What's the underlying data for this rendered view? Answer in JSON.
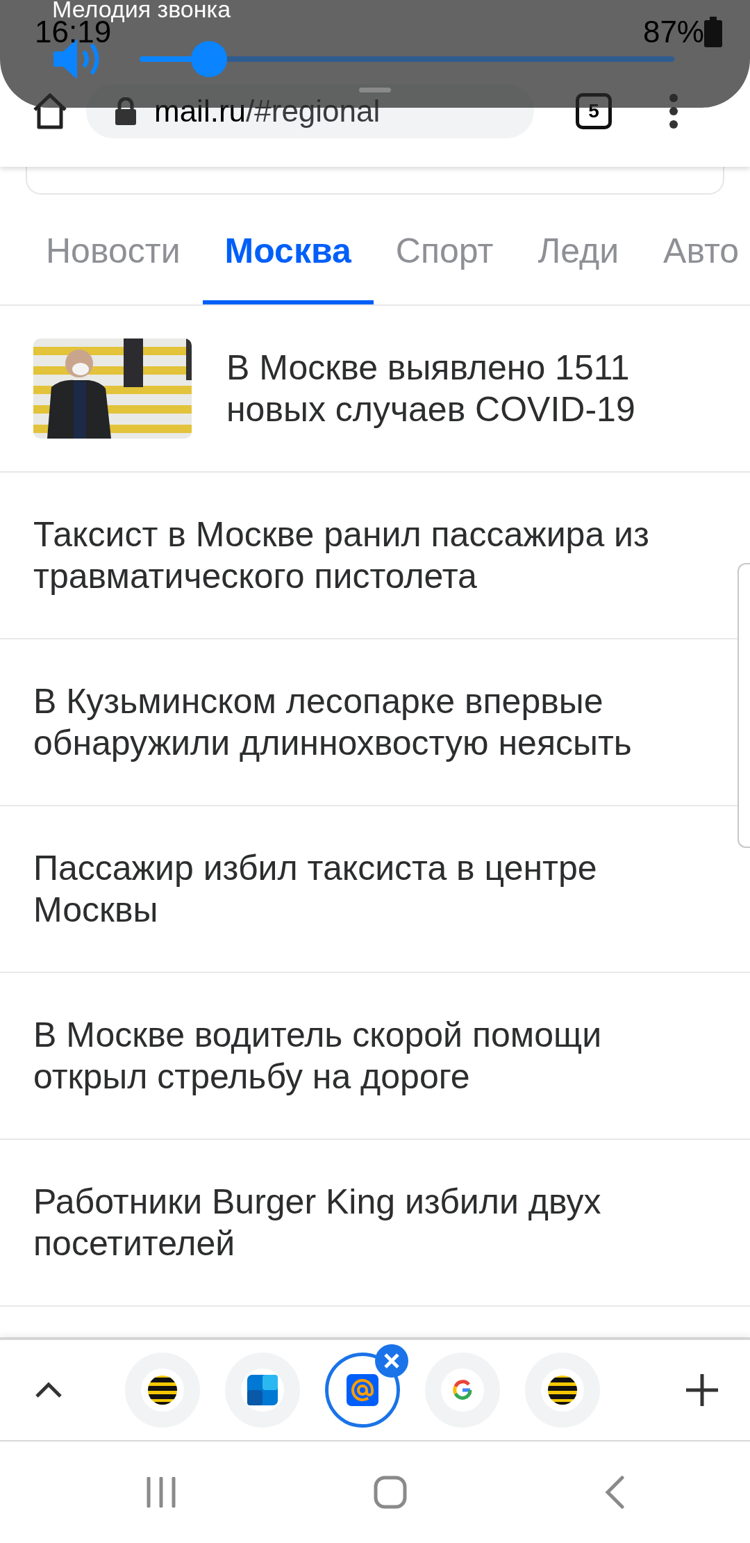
{
  "volume_panel": {
    "title": "Мелодия звонка",
    "level": 0.13
  },
  "status_bar": {
    "time": "16:19",
    "battery": "87%"
  },
  "browser_toolbar": {
    "url_domain": "mail.ru",
    "url_path": "/#regional",
    "tab_count": "5"
  },
  "tabs": [
    {
      "label": "Новости",
      "selected": false
    },
    {
      "label": "Москва",
      "selected": true
    },
    {
      "label": "Спорт",
      "selected": false
    },
    {
      "label": "Леди",
      "selected": false
    },
    {
      "label": "Авто",
      "selected": false
    }
  ],
  "news": [
    {
      "title": "В Москве выявлено 1511 новых случаев COVID-19",
      "kind": "picture"
    },
    {
      "title": "Таксист в Москве ранил пассажира из травматического пистолета",
      "kind": "text"
    },
    {
      "title": "В Кузьминском лесопарке впервые обнаружили длиннохвостую неясыть",
      "kind": "text"
    },
    {
      "title": "Пассажир избил таксиста в центре Москвы",
      "kind": "text"
    },
    {
      "title": "В Москве водитель скорой помощи открыл стрельбу на дороге",
      "kind": "text"
    },
    {
      "title": "Работники Burger King избили двух посетителей",
      "kind": "text"
    }
  ],
  "tab_strip": [
    {
      "kind": "striped-ball",
      "selected": false
    },
    {
      "kind": "tiles",
      "selected": false
    },
    {
      "kind": "at-sign",
      "selected": true
    },
    {
      "kind": "g-logo",
      "selected": false
    },
    {
      "kind": "striped-ball",
      "selected": false
    }
  ]
}
